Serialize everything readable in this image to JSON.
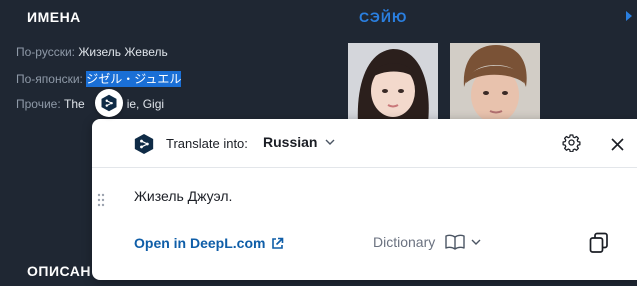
{
  "left_panel": {
    "title": "ИМЕНА",
    "rows": [
      {
        "label": "По-русски:",
        "value": "Жизель Жевель"
      },
      {
        "label": "По-японски:",
        "value": "ジゼル・ジュエル"
      },
      {
        "label": "Прочие:",
        "value_before": "The",
        "value_after": "ie, Gigi"
      }
    ]
  },
  "right_panel": {
    "title": "СЭЙЮ"
  },
  "bottom_section": {
    "title": "ОПИСАН"
  },
  "popup": {
    "translate_into_label": "Translate into:",
    "target_language": "Russian",
    "translation": "Жизель Джуэл.",
    "open_link_label": "Open in DeepL.com",
    "dictionary_label": "Dictionary"
  },
  "icons": {
    "deepl_bubble": "deepl-logo-icon",
    "deepl_header": "deepl-logo-icon",
    "settings": "gear-icon",
    "close": "close-icon",
    "drag": "drag-handle-icon",
    "external_link": "external-link-icon",
    "book": "book-icon",
    "copy": "copy-icon",
    "chevron": "chevron-down-icon",
    "next": "chevron-right-icon"
  },
  "colors": {
    "background": "#1f2733",
    "accent": "#2a7fe0",
    "selection": "#1a6fd6",
    "deepl_navy": "#0f2b46",
    "link": "#0f5ea8"
  }
}
